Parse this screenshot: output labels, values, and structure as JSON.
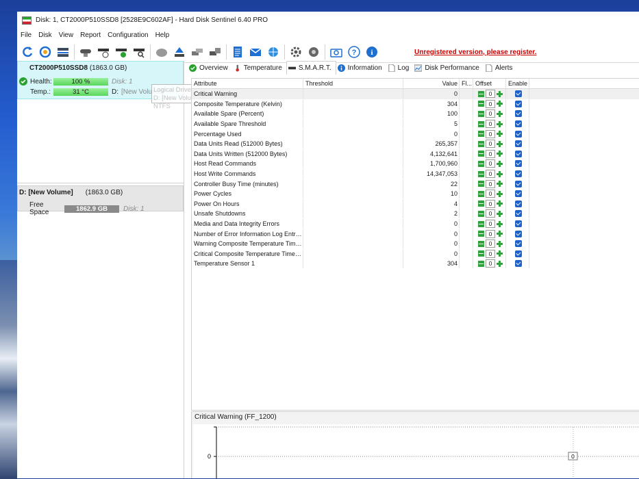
{
  "window": {
    "title": "Disk: 1, CT2000P510SSD8 [2528E9C602AF]  -  Hard Disk Sentinel 6.40 PRO"
  },
  "menu": [
    "File",
    "Disk",
    "View",
    "Report",
    "Configuration",
    "Help"
  ],
  "toolbar": {
    "icons": [
      "refresh-icon",
      "disk-check-icon",
      "disk-list-icon",
      "disk-tools-icon",
      "disk-timer-icon",
      "disk-ok-icon",
      "disk-search-icon",
      "disk-gray-icon",
      "disk-eject-icon",
      "disk-copy-icon",
      "disk-backup-icon",
      "report-icon",
      "email-icon",
      "network-icon",
      "settings-icon",
      "sound-icon",
      "screenshot-icon",
      "help-icon",
      "info-icon"
    ],
    "unregistered": "Unregistered version, please register."
  },
  "disk": {
    "model": "CT2000P510SSD8",
    "size": "(1863.0 GB)",
    "health_label": "Health:",
    "health_value": "100 %",
    "health_disk": "Disk: 1",
    "temp_label": "Temp.:",
    "temp_value": "31 °C",
    "temp_drive": "D:",
    "temp_volume": "[New Volume]"
  },
  "tooltip": {
    "line1": "Logical Drive(s)",
    "line2": "D: [New Volume] NTFS"
  },
  "volume": {
    "name": "D: [New Volume]",
    "size": "(1863.0 GB)",
    "free_label": "Free Space",
    "free_value": "1862.9 GB",
    "disk": "Disk: 1"
  },
  "tabs": [
    "Overview",
    "Temperature",
    "S.M.A.R.T.",
    "Information",
    "Log",
    "Disk Performance",
    "Alerts"
  ],
  "active_tab": "S.M.A.R.T.",
  "smart": {
    "headers": [
      "Attribute",
      "Threshold",
      "Value",
      "Fl...",
      "Offset",
      "Enable"
    ],
    "rows": [
      {
        "attribute": "Critical Warning",
        "value": "0",
        "offset": "0"
      },
      {
        "attribute": "Composite Temperature (Kelvin)",
        "value": "304",
        "offset": "0"
      },
      {
        "attribute": "Available Spare (Percent)",
        "value": "100",
        "offset": "0"
      },
      {
        "attribute": "Available Spare Threshold",
        "value": "5",
        "offset": "0"
      },
      {
        "attribute": "Percentage Used",
        "value": "0",
        "offset": "0"
      },
      {
        "attribute": "Data Units Read (512000 Bytes)",
        "value": "265,357",
        "offset": "0"
      },
      {
        "attribute": "Data Units Written (512000 Bytes)",
        "value": "4,132,641",
        "offset": "0"
      },
      {
        "attribute": "Host Read Commands",
        "value": "1,700,960",
        "offset": "0"
      },
      {
        "attribute": "Host Write Commands",
        "value": "14,347,053",
        "offset": "0"
      },
      {
        "attribute": "Controller Busy Time (minutes)",
        "value": "22",
        "offset": "0"
      },
      {
        "attribute": "Power Cycles",
        "value": "10",
        "offset": "0"
      },
      {
        "attribute": "Power On Hours",
        "value": "4",
        "offset": "0"
      },
      {
        "attribute": "Unsafe Shutdowns",
        "value": "2",
        "offset": "0"
      },
      {
        "attribute": "Media and Data Integrity Errors",
        "value": "0",
        "offset": "0"
      },
      {
        "attribute": "Number of Error Information Log Entries",
        "value": "0",
        "offset": "0"
      },
      {
        "attribute": "Warning Composite Temperature Time (...",
        "value": "0",
        "offset": "0"
      },
      {
        "attribute": "Critical Composite Temperature Time (mi...",
        "value": "0",
        "offset": "0"
      },
      {
        "attribute": "Temperature Sensor 1",
        "value": "304",
        "offset": "0"
      }
    ]
  },
  "graph": {
    "title": "Critical Warning (FF_1200)",
    "y_tick": "0",
    "point_label": "0"
  }
}
